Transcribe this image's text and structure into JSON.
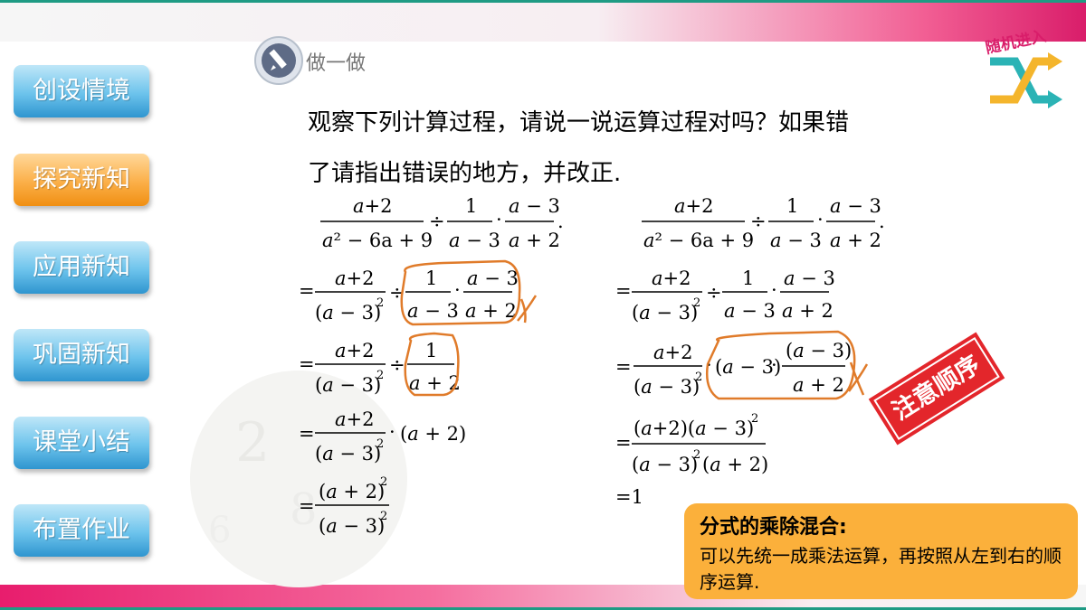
{
  "nav": {
    "items": [
      {
        "label": "创设情境",
        "active": false
      },
      {
        "label": "探究新知",
        "active": true
      },
      {
        "label": "应用新知",
        "active": false
      },
      {
        "label": "巩固新知",
        "active": false
      },
      {
        "label": "课堂小结",
        "active": false
      },
      {
        "label": "布置作业",
        "active": false
      }
    ]
  },
  "section": {
    "title": "做一做",
    "icon": "pencil-icon"
  },
  "logo": {
    "text": "随机进入",
    "icon": "shuffle-arrows-icon"
  },
  "question": {
    "line1": "观察下列计算过程，请说一说运算过程对吗？如果错",
    "line2": "了请指出错误的地方，并改正."
  },
  "math": {
    "a": "a",
    "plus2": "+2",
    "minus3": " − 3",
    "plus2s": " + 2",
    "one": "1",
    "den1": "² − 6a + 9",
    "div": "÷",
    "dot": "·",
    "period": ".",
    "eq": "=",
    "sq": "2",
    "one_result": "=1"
  },
  "stamp": {
    "text": "注意顺序"
  },
  "summary": {
    "title": "分式的乘除混合:",
    "text": "可以先统一成乘法运算，再按照从左到右的顺序运算."
  },
  "colors": {
    "accent": "#1f9b84",
    "nav": "#3aa6de",
    "active": "#f7a02c",
    "annotation": "#e07b2a",
    "stamp": "#e3262b",
    "summary": "#fbb03b"
  }
}
